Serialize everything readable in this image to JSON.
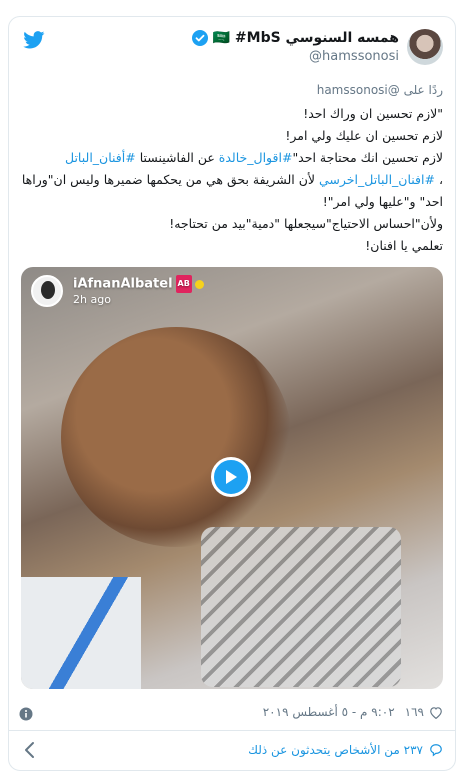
{
  "author": {
    "name": "همسه السنوسي 🇸🇦 #MbS",
    "handle": "@hamssonosi"
  },
  "tweet": {
    "reply_prefix": "ردًا على",
    "reply_mention": "@hamssonosi",
    "line1": "\"لازم تحسين ان وراك احد!",
    "line2": "لازم تحسين ان عليك ولي امر!",
    "line3_text": "لازم تحسين انك محتاجة احد\"",
    "line3_link1": "#اقوال_خالدة",
    "line3_middle": " عن الفاشينستا ",
    "line3_link2": "#أفنان_الباتل",
    "line4_link": "#افنان_الباتل_اخرسي",
    "line4_text": " لأن الشريفة بحق هي من يحكمها ضميرها وليس ان\"وراها احد\" و\"عليها ولي امر\"!",
    "line5": "ولأن\"احساس الاحتياج\"سيجعلها \"دمية\"بيد من تحتاجه!",
    "line6": "تعلمي يا افنان!"
  },
  "video": {
    "username": "iAfnanAlbatel",
    "badge": "AB",
    "time_ago": "2h ago"
  },
  "meta": {
    "likes": "١٦٩",
    "timestamp": "٩:٠٢ م - ٥ أغسطس ٢٠١٩"
  },
  "footer": {
    "people_talking": "٢٣٧ من الأشخاص يتحدثون عن ذلك"
  },
  "colors": {
    "twitter_blue": "#1da1f2",
    "link": "#1b95e0",
    "muted": "#657786"
  },
  "icons": [
    "twitter-logo-icon",
    "verified-badge-icon",
    "play-icon",
    "heart-icon",
    "info-icon",
    "reply-bubble-icon",
    "chevron-left-icon"
  ]
}
